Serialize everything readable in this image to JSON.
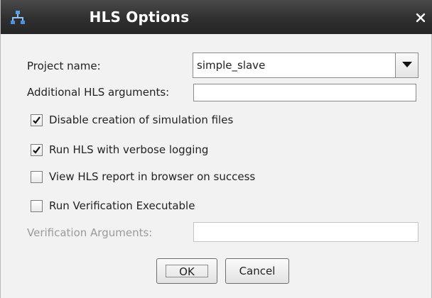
{
  "window": {
    "title": "HLS Options",
    "title_icon": "app-network-icon",
    "close_icon": "close-icon"
  },
  "form": {
    "project_name_label": "Project name:",
    "project_name_value": "simple_slave",
    "additional_args_label": "Additional HLS arguments:",
    "additional_args_value": "",
    "verification_args_label": "Verification Arguments:",
    "verification_args_value": ""
  },
  "checkboxes": [
    {
      "label": "Disable creation of simulation files",
      "checked": true
    },
    {
      "label": "Run HLS with verbose logging",
      "checked": true
    },
    {
      "label": "View HLS report in browser on success",
      "checked": false
    },
    {
      "label": "Run Verification Executable",
      "checked": false
    }
  ],
  "buttons": {
    "ok_label": "OK",
    "cancel_label": "Cancel"
  },
  "colors": {
    "titlebar": "#2f2f2f",
    "dialog_bg": "#f2f2f2",
    "disabled_text": "#9a9a9a"
  }
}
